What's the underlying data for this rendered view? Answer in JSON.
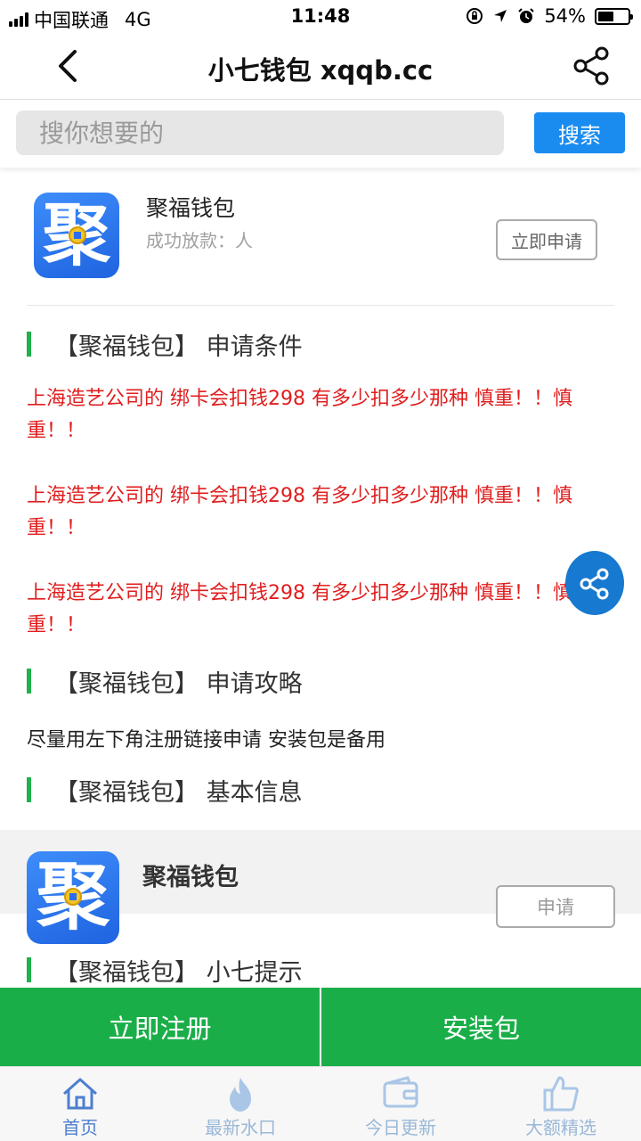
{
  "status_bar": {
    "carrier": "中国联通",
    "network": "4G",
    "time": "11:48",
    "battery": "54%",
    "battery_level": 0.54
  },
  "nav": {
    "title": "小七钱包 xqqb.cc",
    "back_icon": "chevron-left-icon",
    "share_icon": "share-icon"
  },
  "search": {
    "placeholder": "搜你想要的",
    "button_label": "搜索"
  },
  "app": {
    "logo_glyph": "聚",
    "name": "聚福钱包",
    "subtitle": "成功放款：人",
    "apply_label": "立即申请"
  },
  "sections": {
    "conditions": "【聚福钱包】 申请条件",
    "strategy": "【聚福钱包】 申请攻略",
    "basic_info": "【聚福钱包】 基本信息",
    "tips": "【聚福钱包】 小七提示"
  },
  "warnings": [
    "上海造艺公司的 绑卡会扣钱298 有多少扣多少那种 慎重！！慎重！！",
    "上海造艺公司的 绑卡会扣钱298 有多少扣多少那种 慎重！！慎重！！",
    "上海造艺公司的 绑卡会扣钱298 有多少扣多少那种 慎重！！慎重！！"
  ],
  "strategy_text": "尽量用左下角注册链接申请 安装包是备用",
  "info_card": {
    "name": "聚福钱包",
    "apply_label": "申请"
  },
  "actions": {
    "register": "立即注册",
    "install": "安装包"
  },
  "tabs": [
    {
      "label": "首页",
      "icon": "home-icon"
    },
    {
      "label": "最新水口",
      "icon": "flame-icon"
    },
    {
      "label": "今日更新",
      "icon": "wallet-icon"
    },
    {
      "label": "大额精选",
      "icon": "thumbs-up-icon"
    }
  ],
  "colors": {
    "accent_blue": "#1a8cf0",
    "action_green": "#1aae48",
    "section_bar_green": "#1fb14c",
    "warning_red": "#e01e1e",
    "float_share_blue": "#1779d0"
  }
}
